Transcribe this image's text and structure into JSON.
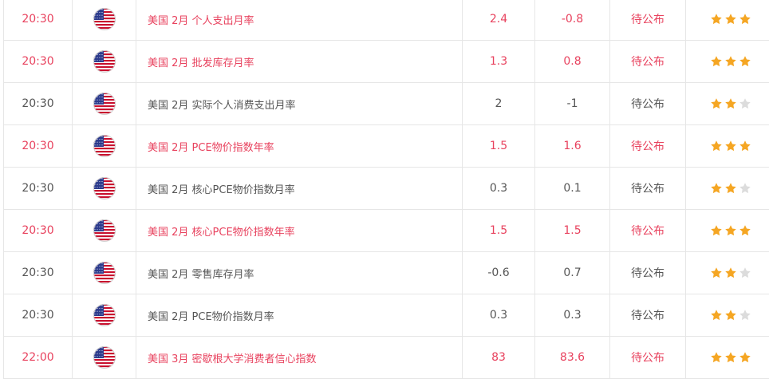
{
  "colors": {
    "highlight_text": "#e8425e",
    "normal_text": "#555555",
    "star_on": "#f5a623",
    "star_off": "#dcdcdc",
    "grid": "#e6e6e6"
  },
  "rows": [
    {
      "time": "20:30",
      "country_flag": "us-flag-icon",
      "event": "美国 2月 个人支出月率",
      "previous": "2.4",
      "forecast": "-0.8",
      "actual": "待公布",
      "importance": 3,
      "highlight": true
    },
    {
      "time": "20:30",
      "country_flag": "us-flag-icon",
      "event": "美国 2月 批发库存月率",
      "previous": "1.3",
      "forecast": "0.8",
      "actual": "待公布",
      "importance": 3,
      "highlight": true
    },
    {
      "time": "20:30",
      "country_flag": "us-flag-icon",
      "event": "美国 2月 实际个人消费支出月率",
      "previous": "2",
      "forecast": "-1",
      "actual": "待公布",
      "importance": 2,
      "highlight": false
    },
    {
      "time": "20:30",
      "country_flag": "us-flag-icon",
      "event": "美国 2月 PCE物价指数年率",
      "previous": "1.5",
      "forecast": "1.6",
      "actual": "待公布",
      "importance": 3,
      "highlight": true
    },
    {
      "time": "20:30",
      "country_flag": "us-flag-icon",
      "event": "美国 2月 核心PCE物价指数月率",
      "previous": "0.3",
      "forecast": "0.1",
      "actual": "待公布",
      "importance": 2,
      "highlight": false
    },
    {
      "time": "20:30",
      "country_flag": "us-flag-icon",
      "event": "美国 2月 核心PCE物价指数年率",
      "previous": "1.5",
      "forecast": "1.5",
      "actual": "待公布",
      "importance": 3,
      "highlight": true
    },
    {
      "time": "20:30",
      "country_flag": "us-flag-icon",
      "event": "美国 2月 零售库存月率",
      "previous": "-0.6",
      "forecast": "0.7",
      "actual": "待公布",
      "importance": 2,
      "highlight": false
    },
    {
      "time": "20:30",
      "country_flag": "us-flag-icon",
      "event": "美国 2月 PCE物价指数月率",
      "previous": "0.3",
      "forecast": "0.3",
      "actual": "待公布",
      "importance": 2,
      "highlight": false
    },
    {
      "time": "22:00",
      "country_flag": "us-flag-icon",
      "event": "美国 3月 密歇根大学消费者信心指数",
      "previous": "83",
      "forecast": "83.6",
      "actual": "待公布",
      "importance": 3,
      "highlight": true
    }
  ]
}
